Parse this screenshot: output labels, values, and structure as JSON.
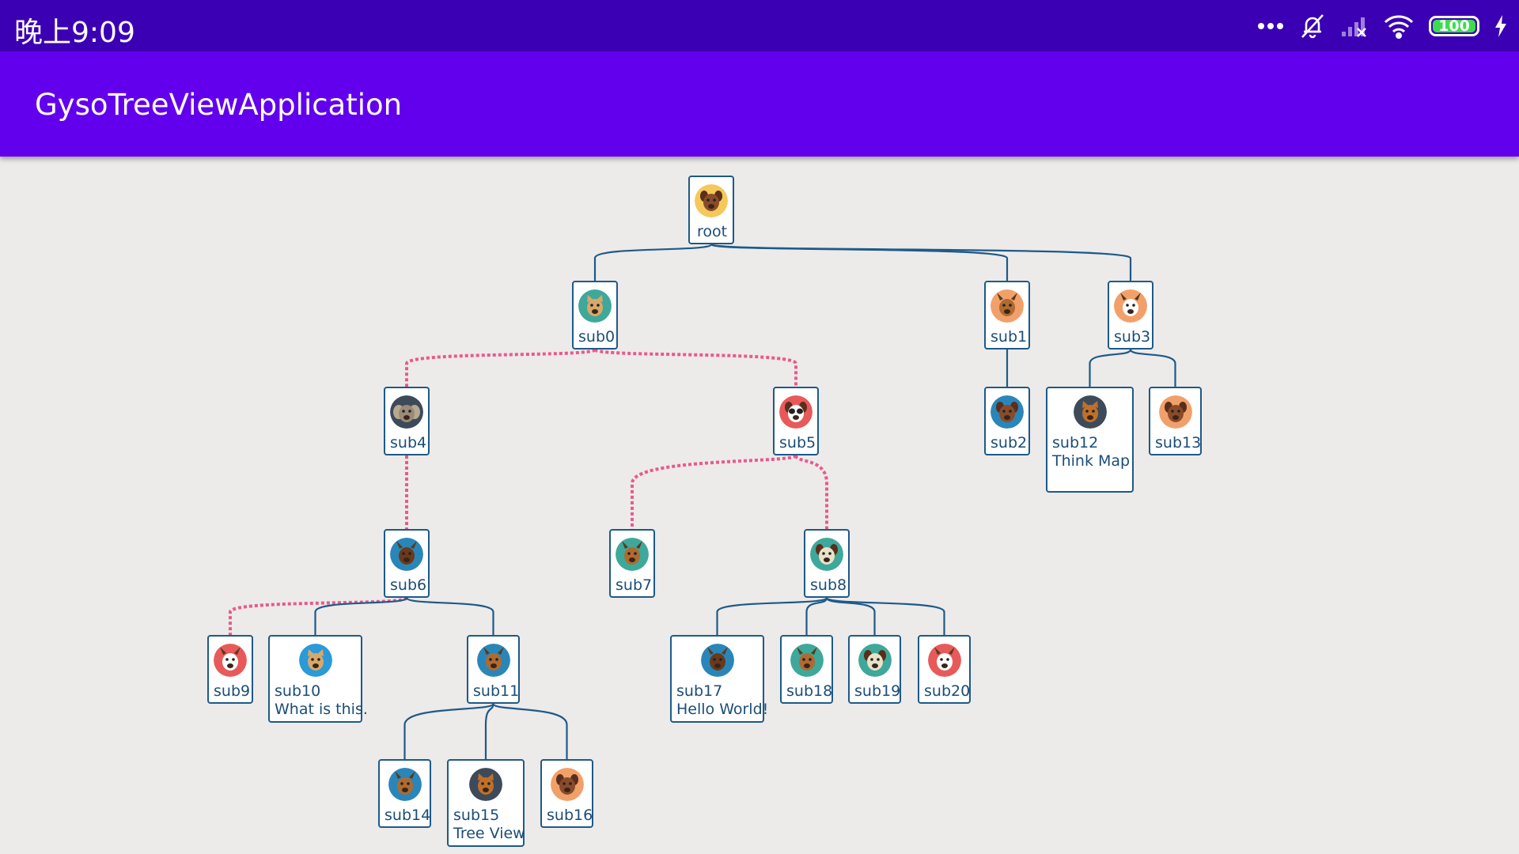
{
  "status_bar": {
    "time": "晚上9:09",
    "battery": "100"
  },
  "app_bar": {
    "title": "GysoTreeViewApplication"
  },
  "colors": {
    "status_bar": "#3c00b4",
    "app_bar": "#6200ee",
    "node_border": "#1d5a88",
    "link_solid": "#1d5a88",
    "link_dashed": "#e85a8c",
    "canvas": "#edeaea"
  },
  "tree": {
    "nodes": [
      {
        "id": "root",
        "label": "root",
        "avatar_bg": "#f4c85a",
        "animal": "dog-icon"
      },
      {
        "id": "sub0",
        "label": "sub0",
        "avatar_bg": "#3ea89a",
        "animal": "leopard-icon"
      },
      {
        "id": "sub1",
        "label": "sub1",
        "avatar_bg": "#f2a06a",
        "animal": "deer-icon"
      },
      {
        "id": "sub3",
        "label": "sub3",
        "avatar_bg": "#f2a06a",
        "animal": "rhino-icon"
      },
      {
        "id": "sub4",
        "label": "sub4",
        "avatar_bg": "#3d4a5a",
        "animal": "elephant-icon"
      },
      {
        "id": "sub5",
        "label": "sub5",
        "avatar_bg": "#e85a5a",
        "animal": "panda-icon"
      },
      {
        "id": "sub2",
        "label": "sub2",
        "avatar_bg": "#2a86b8",
        "animal": "wolf-icon"
      },
      {
        "id": "sub12",
        "label": "sub12",
        "sub": "Think Map",
        "avatar_bg": "#3d4a5a",
        "animal": "lion-icon"
      },
      {
        "id": "sub13",
        "label": "sub13",
        "avatar_bg": "#f2a06a",
        "animal": "pug-icon"
      },
      {
        "id": "sub6",
        "label": "sub6",
        "avatar_bg": "#2a86b8",
        "animal": "bull-icon"
      },
      {
        "id": "sub7",
        "label": "sub7",
        "avatar_bg": "#3ea89a",
        "animal": "deer-icon"
      },
      {
        "id": "sub8",
        "label": "sub8",
        "avatar_bg": "#3ea89a",
        "animal": "sheep-icon"
      },
      {
        "id": "sub9",
        "label": "sub9",
        "avatar_bg": "#e85a5a",
        "animal": "antelope-icon"
      },
      {
        "id": "sub10",
        "label": "sub10",
        "sub": "What is this.",
        "avatar_bg": "#2a9ad8",
        "animal": "cat-icon"
      },
      {
        "id": "sub11",
        "label": "sub11",
        "avatar_bg": "#2a86b8",
        "animal": "kangaroo-icon"
      },
      {
        "id": "sub17",
        "label": "sub17",
        "sub": "Hello World!",
        "avatar_bg": "#2a86b8",
        "animal": "bull-icon"
      },
      {
        "id": "sub18",
        "label": "sub18",
        "avatar_bg": "#3ea89a",
        "animal": "deer-icon"
      },
      {
        "id": "sub19",
        "label": "sub19",
        "avatar_bg": "#3ea89a",
        "animal": "sheep-icon"
      },
      {
        "id": "sub20",
        "label": "sub20",
        "avatar_bg": "#e85a5a",
        "animal": "antelope-icon"
      },
      {
        "id": "sub14",
        "label": "sub14",
        "avatar_bg": "#2a86b8",
        "animal": "kangaroo-icon"
      },
      {
        "id": "sub15",
        "label": "sub15",
        "sub": "Tree View",
        "avatar_bg": "#3d4a5a",
        "animal": "lion-icon"
      },
      {
        "id": "sub16",
        "label": "sub16",
        "avatar_bg": "#f2a06a",
        "animal": "pug-icon"
      }
    ],
    "links": [
      {
        "from": "root",
        "to": "sub0",
        "style": "solid"
      },
      {
        "from": "root",
        "to": "sub1",
        "style": "solid"
      },
      {
        "from": "root",
        "to": "sub3",
        "style": "solid"
      },
      {
        "from": "sub0",
        "to": "sub4",
        "style": "dashed"
      },
      {
        "from": "sub0",
        "to": "sub5",
        "style": "dashed"
      },
      {
        "from": "sub1",
        "to": "sub2",
        "style": "solid"
      },
      {
        "from": "sub3",
        "to": "sub12",
        "style": "solid"
      },
      {
        "from": "sub3",
        "to": "sub13",
        "style": "solid"
      },
      {
        "from": "sub4",
        "to": "sub6",
        "style": "dashed"
      },
      {
        "from": "sub5",
        "to": "sub7",
        "style": "dashed"
      },
      {
        "from": "sub5",
        "to": "sub8",
        "style": "dashed"
      },
      {
        "from": "sub6",
        "to": "sub9",
        "style": "dashed"
      },
      {
        "from": "sub6",
        "to": "sub10",
        "style": "solid"
      },
      {
        "from": "sub6",
        "to": "sub11",
        "style": "solid"
      },
      {
        "from": "sub8",
        "to": "sub17",
        "style": "solid"
      },
      {
        "from": "sub8",
        "to": "sub18",
        "style": "solid"
      },
      {
        "from": "sub8",
        "to": "sub19",
        "style": "solid"
      },
      {
        "from": "sub8",
        "to": "sub20",
        "style": "solid"
      },
      {
        "from": "sub11",
        "to": "sub14",
        "style": "solid"
      },
      {
        "from": "sub11",
        "to": "sub15",
        "style": "solid"
      },
      {
        "from": "sub11",
        "to": "sub16",
        "style": "solid"
      }
    ]
  }
}
